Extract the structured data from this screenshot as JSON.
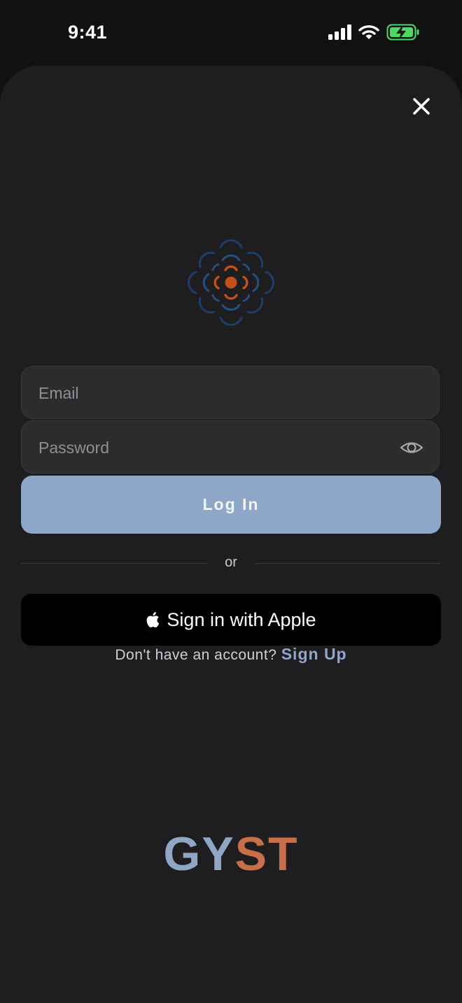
{
  "status_bar": {
    "time": "9:41",
    "icons": [
      "cellular-signal-icon",
      "wifi-icon",
      "battery-charging-icon"
    ]
  },
  "sheet": {
    "close_icon": "close-icon",
    "logo_icon": "flower-logo-icon"
  },
  "form": {
    "email_placeholder": "Email",
    "password_placeholder": "Password",
    "password_toggle_icon": "eye-icon",
    "login_label": "Log In",
    "or_label": "or",
    "apple_label": "Sign in with Apple",
    "apple_icon": "apple-icon",
    "signup_prompt": "Don't have an account?",
    "signup_link": "Sign Up"
  },
  "brand": {
    "letters_part1": "GY",
    "letters_part2": "ST"
  },
  "colors": {
    "sheet_background": "#1e1e20",
    "accent_blue": "#8ea6c7",
    "accent_orange": "#c86f4a",
    "battery_green": "#4cd964"
  }
}
